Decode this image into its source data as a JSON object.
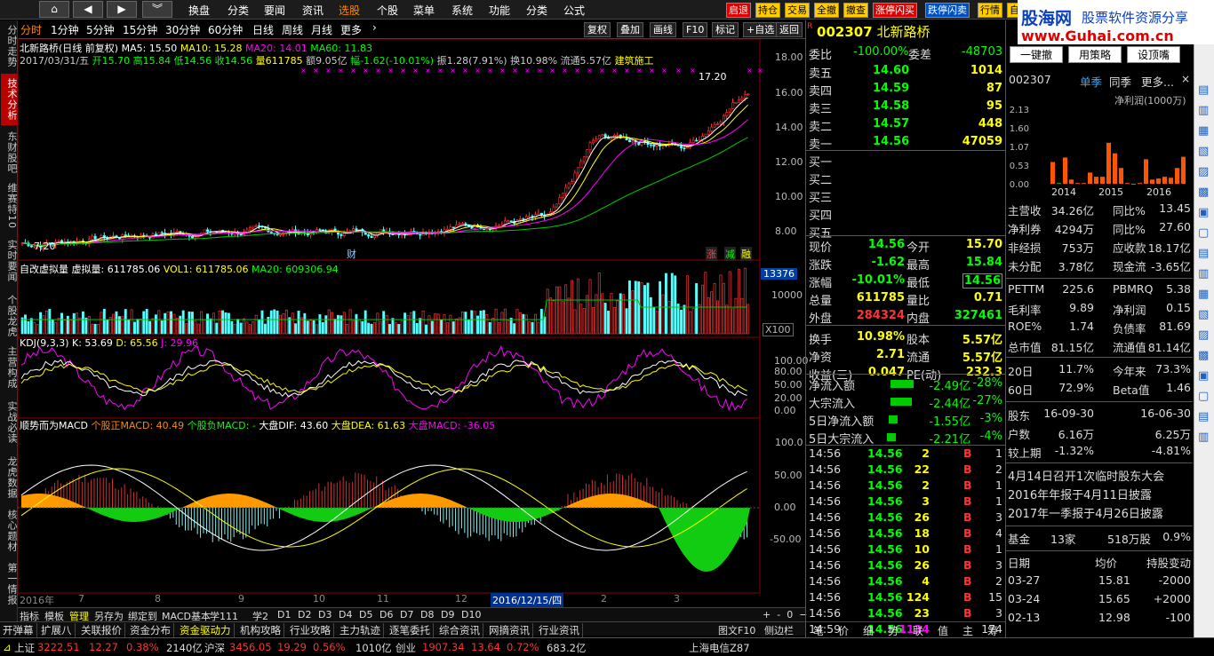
{
  "topbar": {
    "menus": [
      "换盘",
      "分类",
      "要闻",
      "资讯",
      "选股",
      "个股",
      "菜单",
      "系统",
      "功能",
      "分类",
      "公式"
    ],
    "active": "选股",
    "buttons": [
      {
        "label": "启退",
        "bg": "#d00",
        "fg": "#fff"
      },
      {
        "label": "持仓",
        "bg": "#ffcc00",
        "fg": "#000"
      },
      {
        "label": "交易",
        "bg": "#ffcc00",
        "fg": "#000"
      },
      {
        "label": "全撤",
        "bg": "#ffcc00",
        "fg": "#000"
      },
      {
        "label": "撤查",
        "bg": "#ffcc00",
        "fg": "#000"
      },
      {
        "label": "涨停闪买",
        "bg": "#d00",
        "fg": "#fff"
      },
      {
        "label": "跌停闪卖",
        "bg": "#0050c0",
        "fg": "#fff"
      },
      {
        "label": "行情",
        "bg": "#ffcc00",
        "fg": "#000"
      },
      {
        "label": "自",
        "bg": "#ffcc00",
        "fg": "#000"
      }
    ]
  },
  "logo": {
    "line1": "股海网",
    "line2": "www.Guhai.com.cn",
    "tag": "股票软件资源分享"
  },
  "leftnav": [
    "分时走势",
    "技术分析",
    "东财股吧",
    "维赛特10",
    "实时要闻",
    "个股龙虎",
    "主营构成",
    "实战必读",
    "龙虎数据",
    "核心题材",
    "第一情报"
  ],
  "leftnav_active": "技术分析",
  "periods": [
    "分时",
    "1分钟",
    "5分钟",
    "15分钟",
    "30分钟",
    "60分钟",
    "日线",
    "周线",
    "月线",
    "更多"
  ],
  "period_active": "分时",
  "toolbar": [
    "复权",
    "叠加",
    "画线",
    "F10",
    "标记",
    "+自选",
    "返回"
  ],
  "chart_title": {
    "name": "北新路桥(日线 前复权)",
    "ma5": "MA5: 15.50",
    "ma10": "MA10: 15.28",
    "ma20": "MA20: 14.01",
    "ma60": "MA60: 11.83"
  },
  "bar_info": {
    "date": "2017/03/31/五",
    "open": "开15.70",
    "high": "高15.84",
    "low": "低14.56",
    "close": "收14.56",
    "vol": "量611785",
    "amt": "额9.05亿",
    "chg": "幅-1.62(-10.01%)",
    "amp": "振1.28(7.91%)",
    "turn": "换10.98%",
    "float": "流通5.57亿",
    "ind": "建筑施工"
  },
  "price_axis": [
    "18.00",
    "16.00",
    "14.00",
    "12.00",
    "10.00",
    "8.00"
  ],
  "chart_marks": {
    "high": "17.20",
    "low": "7.20",
    "cai": "财",
    "zhang": "涨",
    "jian": "减",
    "rong": "融"
  },
  "vol_title": {
    "a": "自改虚拟量",
    "b": "虚拟量: 611785.06",
    "c": "VOL1: 611785.06",
    "d": "MA20: 609306.94"
  },
  "vol_axis": {
    "box": "13376",
    "v1": "10000",
    "unit": "X100"
  },
  "kdj_title": {
    "a": "KDJ(9,3,3)",
    "k": "K: 53.69",
    "d": "D: 65.56",
    "j": "J: 29.96"
  },
  "kdj_axis": [
    "100.00",
    "80.00",
    "50.00",
    "20.00",
    "0.00"
  ],
  "macd_title": {
    "a": "顺势而为MACD",
    "b": "个股正MACD: 40.49",
    "c": "个股负MACD: -",
    "d": "大盘DIF: 43.60",
    "e": "大盘DEA: 61.63",
    "f": "大盘MACD: -36.05"
  },
  "macd_axis": [
    "100.0",
    "50.00",
    "0.00",
    "-50.00"
  ],
  "time_axis": [
    "2016年",
    "7",
    "8",
    "9",
    "10",
    "11",
    "12",
    "2016/12/15/四",
    "2",
    "3"
  ],
  "stock": {
    "code": "002307",
    "name": "北新路桥"
  },
  "quote": {
    "weibi": "-100.00%",
    "weicha": "-48703",
    "asks": [
      {
        "label": "卖五",
        "price": "14.60",
        "vol": "1014"
      },
      {
        "label": "卖四",
        "price": "14.59",
        "vol": "87"
      },
      {
        "label": "卖三",
        "price": "14.58",
        "vol": "95"
      },
      {
        "label": "卖二",
        "price": "14.57",
        "vol": "448"
      },
      {
        "label": "卖一",
        "price": "14.56",
        "vol": "47059"
      }
    ],
    "bids": [
      "买一",
      "买二",
      "买三",
      "买四",
      "买五"
    ],
    "rows": [
      [
        "现价",
        "14.56",
        "今开",
        "15.70"
      ],
      [
        "涨跌",
        "-1.62",
        "最高",
        "15.84"
      ],
      [
        "涨幅",
        "-10.01%",
        "最低",
        "14.56"
      ],
      [
        "总量",
        "611785",
        "量比",
        "0.71"
      ],
      [
        "外盘",
        "284324",
        "内盘",
        "327461"
      ],
      [
        "换手",
        "10.98%",
        "股本",
        "5.57亿"
      ],
      [
        "净资",
        "2.71",
        "流通",
        "5.57亿"
      ],
      [
        "收益(三)",
        "0.047",
        "PE(动)",
        "232.3"
      ]
    ]
  },
  "flows": [
    [
      "净流入额",
      "-2.49亿",
      "-28%"
    ],
    [
      "大宗流入",
      "-2.44亿",
      "-27%"
    ],
    [
      "5日净流入额",
      "-1.55亿",
      "-3%"
    ],
    [
      "5日大宗流入",
      "-2.21亿",
      "-4%"
    ]
  ],
  "ticks": [
    [
      "14:56",
      "14.56",
      "2",
      "B",
      "1"
    ],
    [
      "14:56",
      "14.56",
      "22",
      "B",
      "2"
    ],
    [
      "14:56",
      "14.56",
      "2",
      "B",
      "1"
    ],
    [
      "14:56",
      "14.56",
      "3",
      "B",
      "1"
    ],
    [
      "14:56",
      "14.56",
      "26",
      "B",
      "3"
    ],
    [
      "14:56",
      "14.56",
      "18",
      "B",
      "4"
    ],
    [
      "14:56",
      "14.56",
      "10",
      "B",
      "1"
    ],
    [
      "14:56",
      "14.56",
      "26",
      "B",
      "3"
    ],
    [
      "14:56",
      "14.56",
      "4",
      "B",
      "2"
    ],
    [
      "14:56",
      "14.56",
      "124",
      "B",
      "15"
    ],
    [
      "14:56",
      "14.56",
      "23",
      "B",
      "3"
    ],
    [
      "14:59",
      "14.56",
      "1134",
      "",
      "174"
    ]
  ],
  "quote_tabs": [
    "笔",
    "价",
    "细",
    "势",
    "联",
    "值",
    "主",
    "筹"
  ],
  "fin": {
    "btns": [
      "一键撤",
      "用策略",
      "设顶嘴"
    ],
    "code": "002307",
    "tabs": [
      "单季",
      "同季",
      "更多..."
    ],
    "chart_label": "净利润(1000万)",
    "yaxis": [
      "2.13",
      "1.60",
      "1.07",
      "0.53",
      "0.00"
    ],
    "years": [
      "2014",
      "2015",
      "2016"
    ],
    "bars": [
      0.62,
      0.02,
      0.75,
      0.12,
      0.02,
      0.02,
      0.32,
      0.2,
      0.2,
      1.17,
      0.87,
      0.45,
      0.02,
      0.0,
      0.02,
      0.7,
      0.12,
      0.15,
      0.2,
      0.17,
      0.45,
      0.77,
      0.02
    ],
    "rows": [
      [
        "主营收",
        "34.26亿",
        "同比%",
        "13.45"
      ],
      [
        "净利券",
        "4294万",
        "同比%",
        "27.60"
      ],
      [
        "非经损",
        "753万",
        "应收款",
        "18.17亿"
      ],
      [
        "未分配",
        "3.78亿",
        "现金流",
        "-3.65亿"
      ],
      [
        "PETTM",
        "225.6",
        "PBMRQ",
        "5.38"
      ],
      [
        "毛利率",
        "9.89",
        "净利润",
        "0.15"
      ],
      [
        "ROE%",
        "1.74",
        "负债率",
        "81.69"
      ],
      [
        "总市值",
        "81.15亿",
        "流通值",
        "81.14亿"
      ],
      [
        "20日",
        "11.7%",
        "今年来",
        "73.3%"
      ],
      [
        "60日",
        "72.9%",
        "Beta值",
        "1.46"
      ],
      [
        "股东",
        "16-09-30",
        "",
        "16-06-30"
      ],
      [
        "户数",
        "6.16万",
        "",
        "6.25万"
      ],
      [
        "较上期",
        "-1.32%",
        "",
        "-4.81%"
      ]
    ],
    "notices": [
      "4月14日召开1次临时股东大会",
      "2016年年报于4月11日披露",
      "2017年一季报于4月26日披露"
    ],
    "fund": [
      "基金",
      "13家",
      "518万股",
      "0.9%"
    ],
    "holdhead": [
      "日期",
      "均价",
      "持股变动"
    ],
    "hold": [
      [
        "03-27",
        "15.81",
        "-2000"
      ],
      [
        "03-24",
        "15.65",
        "+2000"
      ],
      [
        "02-13",
        "12.98",
        "-100"
      ]
    ]
  },
  "bottom": {
    "row1": [
      "指标",
      "模板",
      "管理",
      "另存为",
      "绑定到",
      "MACD基本",
      "学111",
      "学2",
      "D1",
      "D2",
      "D3",
      "D4",
      "D5",
      "D6",
      "D7",
      "D8",
      "D9",
      "D10"
    ],
    "row2": [
      "开弹幕",
      "扩展八",
      "关联报价",
      "资金分布",
      "资金驱动力",
      "机构攻略",
      "行业攻略",
      "主力轨迹",
      "逐笔委托",
      "综合资讯",
      "网摘资讯",
      "行业资讯"
    ],
    "right": [
      "图文F10",
      "侧边栏"
    ]
  },
  "status": {
    "sh": "上证",
    "shv": "3222.51",
    "shc": "12.27",
    "shp": "0.38%",
    "shamt": "2140亿",
    "hs": "沪深",
    "hsv": "3456.05",
    "hsc": "19.29",
    "hsp": "0.56%",
    "hsamt": "1010亿",
    "cy": "创业",
    "cyv": "1907.34",
    "cyc": "13.64",
    "cyp": "0.72%",
    "cyamt": "683.2亿",
    "isp": "上海电信Z87"
  }
}
